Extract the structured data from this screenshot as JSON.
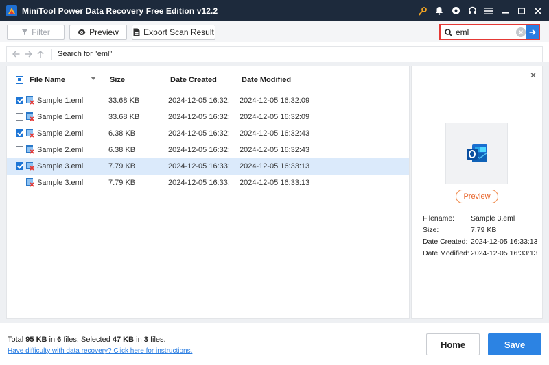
{
  "window": {
    "title": "MiniTool Power Data Recovery Free Edition v12.2"
  },
  "title_icons": [
    "key-icon",
    "bell-icon",
    "disc-icon",
    "headset-icon",
    "menu-icon",
    "minimize-icon",
    "maximize-icon",
    "close-icon"
  ],
  "toolbar": {
    "filter_label": "Filter",
    "preview_label": "Preview",
    "export_label": "Export Scan Result"
  },
  "search": {
    "value": "eml"
  },
  "address": {
    "text": "Search for  \"eml\""
  },
  "table": {
    "headers": {
      "name": "File Name",
      "size": "Size",
      "created": "Date Created",
      "modified": "Date Modified"
    },
    "rows": [
      {
        "checked": true,
        "name": "Sample 1.eml",
        "size": "33.68 KB",
        "created": "2024-12-05 16:32:09",
        "modified": "2024-12-05 16:32:09",
        "selected": false
      },
      {
        "checked": false,
        "name": "Sample 1.eml",
        "size": "33.68 KB",
        "created": "2024-12-05 16:32:09",
        "modified": "2024-12-05 16:32:09",
        "selected": false
      },
      {
        "checked": true,
        "name": "Sample 2.eml",
        "size": "6.38 KB",
        "created": "2024-12-05 16:32:43",
        "modified": "2024-12-05 16:32:43",
        "selected": false
      },
      {
        "checked": false,
        "name": "Sample 2.eml",
        "size": "6.38 KB",
        "created": "2024-12-05 16:32:43",
        "modified": "2024-12-05 16:32:43",
        "selected": false
      },
      {
        "checked": true,
        "name": "Sample 3.eml",
        "size": "7.79 KB",
        "created": "2024-12-05 16:33:13",
        "modified": "2024-12-05 16:33:13",
        "selected": true
      },
      {
        "checked": false,
        "name": "Sample 3.eml",
        "size": "7.79 KB",
        "created": "2024-12-05 16:33:13",
        "modified": "2024-12-05 16:33:13",
        "selected": false
      }
    ]
  },
  "preview_panel": {
    "button_label": "Preview",
    "filename_label": "Filename:",
    "filename_value": "Sample 3.eml",
    "size_label": "Size:",
    "size_value": "7.79 KB",
    "created_label": "Date Created:",
    "created_value": "2024-12-05 16:33:13",
    "modified_label": "Date Modified:",
    "modified_value": "2024-12-05 16:33:13"
  },
  "status": {
    "total_prefix": "Total ",
    "total_size": "95 KB",
    "in_text": " in ",
    "total_files": "6",
    "files_text": " files.  Selected ",
    "selected_size": "47 KB",
    "selected_in": " in ",
    "selected_files": "3",
    "selected_suffix": " files.",
    "help_link": "Have difficulty with data recovery? Click here for instructions."
  },
  "buttons": {
    "home": "Home",
    "save": "Save"
  },
  "colors": {
    "titlebar": "#1d2a3c",
    "accent": "#2c83e3",
    "search_highlight": "#e53935",
    "preview_orange": "#e8642a",
    "selected_row": "#dbeafb"
  }
}
